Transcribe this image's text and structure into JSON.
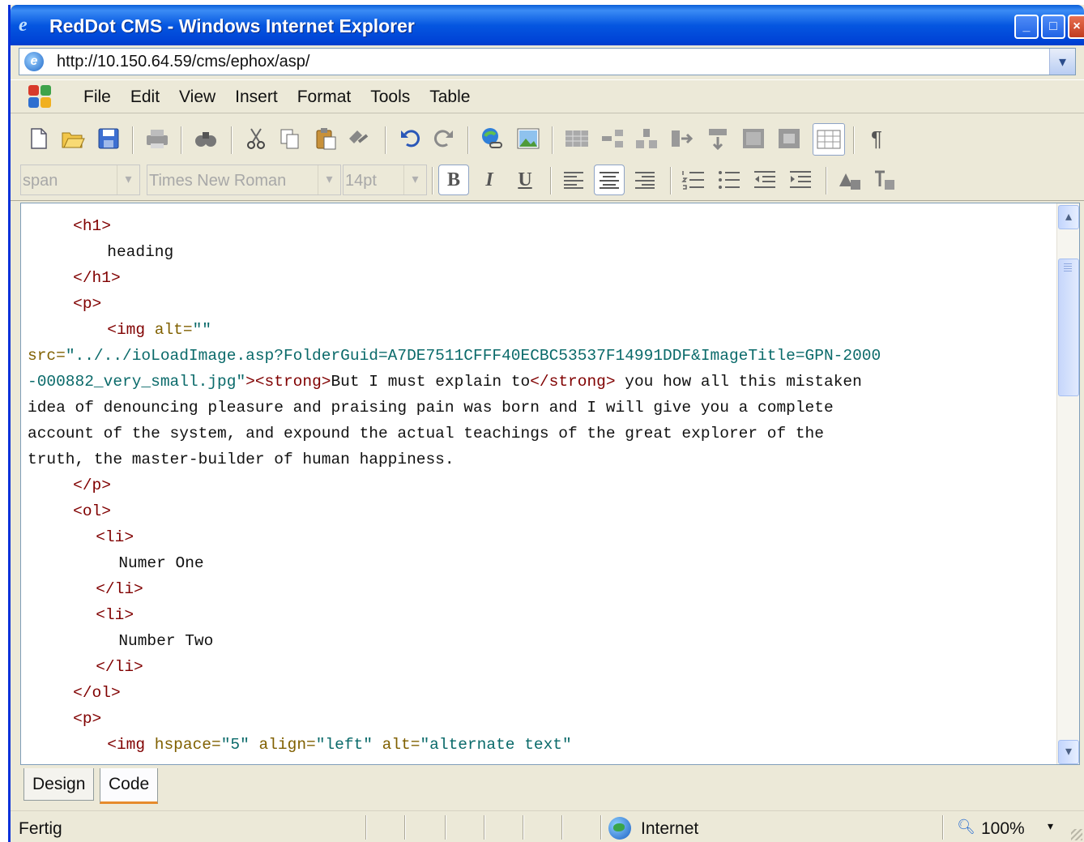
{
  "window": {
    "title": "RedDot CMS - Windows Internet Explorer",
    "minimize_glyph": "_",
    "maximize_glyph": "□",
    "close_glyph": "×"
  },
  "address": {
    "url": "http://10.150.64.59/cms/ephox/asp/",
    "dropdown_glyph": "▾"
  },
  "menu": {
    "items": [
      "File",
      "Edit",
      "View",
      "Insert",
      "Format",
      "Tools",
      "Table"
    ]
  },
  "toolbar": {
    "icons": [
      "new-icon",
      "open-icon",
      "save-icon",
      "print-icon",
      "find-icon",
      "cut-icon",
      "copy-icon",
      "paste-icon",
      "format-painter-icon",
      "undo-icon",
      "redo-icon",
      "insert-link-icon",
      "insert-image-icon",
      "insert-table-icon",
      "insert-row-icon",
      "insert-column-icon",
      "merge-cells-icon",
      "split-cells-icon",
      "table-properties-icon",
      "cell-properties-icon",
      "show-gridlines-icon",
      "pilcrow-icon"
    ],
    "pilcrow": "¶"
  },
  "format_bar": {
    "style_value": "span",
    "font_value": "Times New Roman",
    "size_value": "14pt",
    "bold_label": "B",
    "italic_label": "I",
    "underline_label": "U"
  },
  "editor": {
    "lines": [
      {
        "indent": 4,
        "parts": [
          {
            "t": "tag",
            "v": "<h1>"
          }
        ]
      },
      {
        "indent": 7,
        "parts": [
          {
            "t": "txt",
            "v": "heading"
          }
        ]
      },
      {
        "indent": 4,
        "parts": [
          {
            "t": "tag",
            "v": "</h1>"
          }
        ]
      },
      {
        "indent": 4,
        "parts": [
          {
            "t": "tag",
            "v": "<p>"
          }
        ]
      },
      {
        "indent": 7,
        "parts": [
          {
            "t": "tag",
            "v": "<img "
          },
          {
            "t": "attr",
            "v": "alt="
          },
          {
            "t": "val",
            "v": "\"\""
          }
        ]
      },
      {
        "indent": 0,
        "parts": [
          {
            "t": "attr",
            "v": "src="
          },
          {
            "t": "val",
            "v": "\"../../ioLoadImage.asp?FolderGuid=A7DE7511CFFF40ECBC53537F14991DDF&ImageTitle=GPN-2000"
          }
        ]
      },
      {
        "indent": 0,
        "parts": [
          {
            "t": "val",
            "v": "-000882_very_small.jpg\""
          },
          {
            "t": "tag",
            "v": "><strong>"
          },
          {
            "t": "txt",
            "v": "But I must explain to"
          },
          {
            "t": "tag",
            "v": "</strong>"
          },
          {
            "t": "txt",
            "v": " you how all this mistaken"
          }
        ]
      },
      {
        "indent": 0,
        "parts": [
          {
            "t": "txt",
            "v": "idea of denouncing pleasure and praising pain was born and I will give you a complete"
          }
        ]
      },
      {
        "indent": 0,
        "parts": [
          {
            "t": "txt",
            "v": "account of the system, and expound the actual teachings of the great explorer of the"
          }
        ]
      },
      {
        "indent": 0,
        "parts": [
          {
            "t": "txt",
            "v": "truth, the master-builder of human happiness."
          }
        ]
      },
      {
        "indent": 4,
        "parts": [
          {
            "t": "tag",
            "v": "</p>"
          }
        ]
      },
      {
        "indent": 4,
        "parts": [
          {
            "t": "tag",
            "v": "<ol>"
          }
        ]
      },
      {
        "indent": 6,
        "parts": [
          {
            "t": "tag",
            "v": "<li>"
          }
        ]
      },
      {
        "indent": 8,
        "parts": [
          {
            "t": "txt",
            "v": "Numer One"
          }
        ]
      },
      {
        "indent": 6,
        "parts": [
          {
            "t": "tag",
            "v": "</li>"
          }
        ]
      },
      {
        "indent": 6,
        "parts": [
          {
            "t": "tag",
            "v": "<li>"
          }
        ]
      },
      {
        "indent": 8,
        "parts": [
          {
            "t": "txt",
            "v": "Number Two"
          }
        ]
      },
      {
        "indent": 6,
        "parts": [
          {
            "t": "tag",
            "v": "</li>"
          }
        ]
      },
      {
        "indent": 4,
        "parts": [
          {
            "t": "tag",
            "v": "</ol>"
          }
        ]
      },
      {
        "indent": 4,
        "parts": [
          {
            "t": "tag",
            "v": "<p>"
          }
        ]
      },
      {
        "indent": 7,
        "parts": [
          {
            "t": "tag",
            "v": "<img "
          },
          {
            "t": "attr",
            "v": "hspace="
          },
          {
            "t": "val",
            "v": "\"5\""
          },
          {
            "t": "attr",
            "v": " align="
          },
          {
            "t": "val",
            "v": "\"left\""
          },
          {
            "t": "attr",
            "v": " alt="
          },
          {
            "t": "val",
            "v": "\"alternate text\""
          }
        ]
      }
    ],
    "scroll_up_glyph": "▴",
    "scroll_down_glyph": "▾"
  },
  "tabs": {
    "design_label": "Design",
    "code_label": "Code",
    "active": "Code"
  },
  "status": {
    "text": "Fertig",
    "zone": "Internet",
    "zoom": "100%",
    "zoom_drop": "▾"
  },
  "colors": {
    "tag": "#800000",
    "attribute": "#806000",
    "value": "#0a6a6a",
    "title_bar": "#0556e0"
  }
}
